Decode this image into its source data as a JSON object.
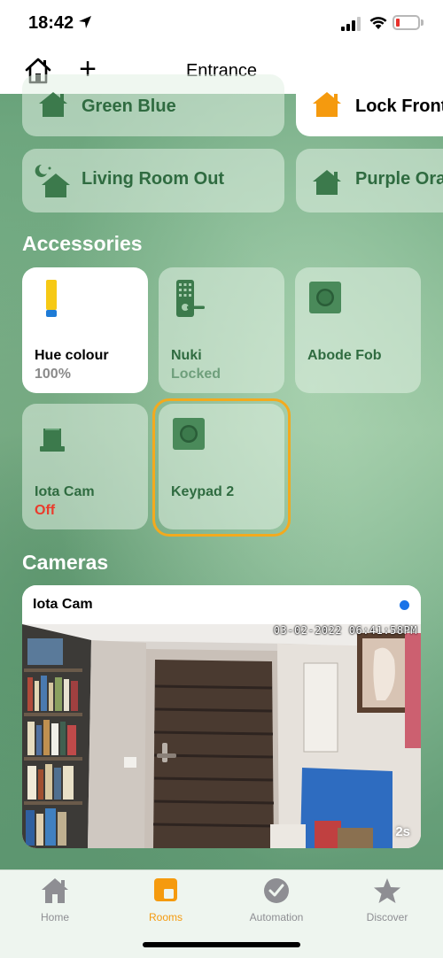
{
  "status_bar": {
    "time": "18:42"
  },
  "header": {
    "title": "Entrance",
    "add_label": "+"
  },
  "scenes": [
    {
      "label": "Green Blue",
      "icon": "house-icon",
      "active": false
    },
    {
      "label": "Lock Front",
      "icon": "house-icon",
      "active": true
    },
    {
      "label": "Living Room Out",
      "icon": "moon-house-icon",
      "active": false
    },
    {
      "label": "Purple Ora",
      "icon": "house-icon",
      "active": false
    }
  ],
  "accessories": {
    "title": "Accessories",
    "tiles": [
      {
        "name": "Hue colour",
        "status": "100%",
        "icon": "light-bulb-icon",
        "on": true
      },
      {
        "name": "Nuki",
        "status": "Locked",
        "icon": "door-lock-icon",
        "on": false
      },
      {
        "name": "Abode Fob",
        "status": "",
        "icon": "button-icon",
        "on": false
      },
      {
        "name": "Iota Cam",
        "status": "Off",
        "icon": "camera-icon",
        "on": false
      },
      {
        "name": "Keypad 2",
        "status": "",
        "icon": "button-icon",
        "on": false,
        "selected": true
      }
    ]
  },
  "cameras": {
    "title": "Cameras",
    "feed": {
      "name": "Iota Cam",
      "timestamp": "03-02-2022 06:41:58PM",
      "age": "2s"
    }
  },
  "tab_bar": {
    "tabs": [
      {
        "label": "Home",
        "icon": "home-icon",
        "active": false
      },
      {
        "label": "Rooms",
        "icon": "rooms-icon",
        "active": true
      },
      {
        "label": "Automation",
        "icon": "clock-icon",
        "active": false
      },
      {
        "label": "Discover",
        "icon": "star-icon",
        "active": false
      }
    ]
  },
  "colors": {
    "accent": "#f59a0e",
    "selection": "#f3aa1e",
    "tile_text": "#2f6b40",
    "off_status": "#ea3b2c"
  }
}
